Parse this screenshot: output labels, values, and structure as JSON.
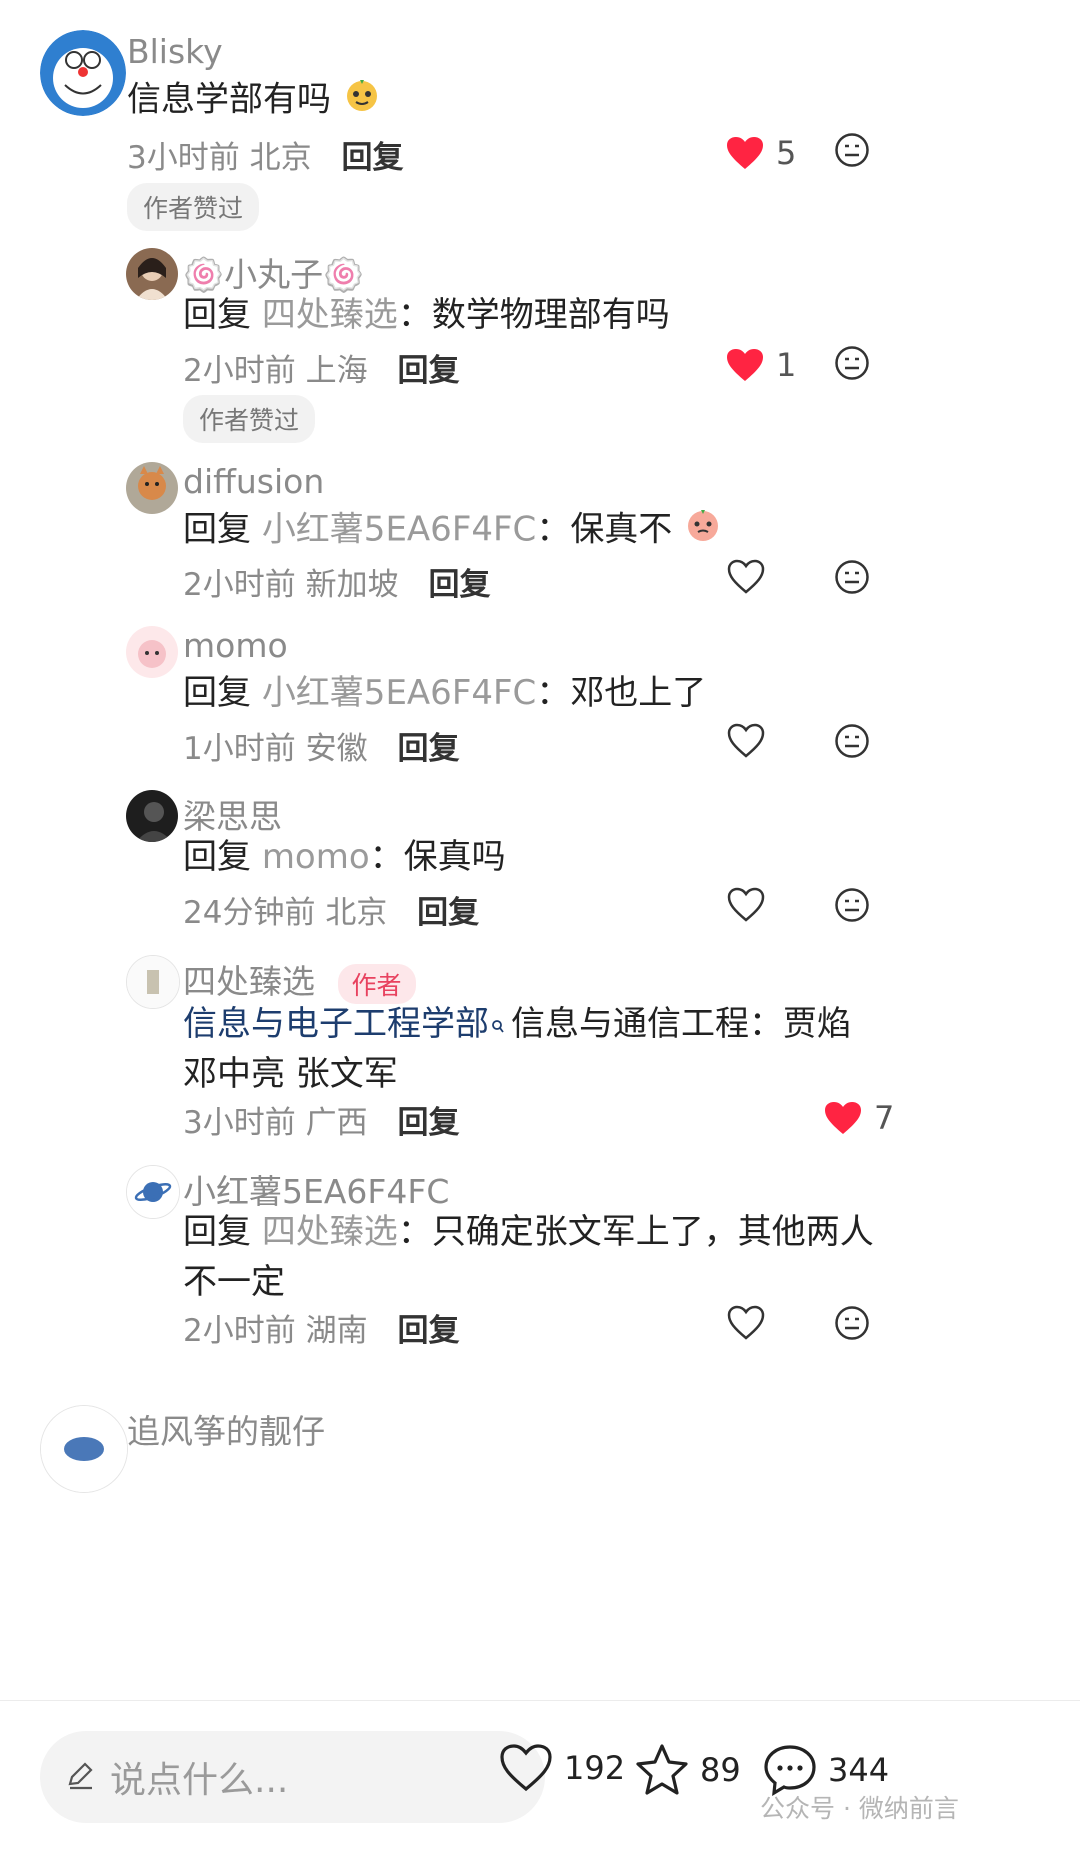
{
  "comments": [
    {
      "name": "Blisky",
      "text": "信息学部有吗",
      "meta_time": "3小时前",
      "meta_loc": "北京",
      "reply": "回复",
      "likes": "5",
      "liked": true,
      "badge": "作者赞过"
    },
    {
      "name": "🍥小丸子🍥",
      "reply_prefix": "回复",
      "mention": "四处臻选",
      "sep": "：",
      "text": "数学物理部有吗",
      "meta_time": "2小时前",
      "meta_loc": "上海",
      "reply": "回复",
      "likes": "1",
      "liked": true,
      "badge": "作者赞过"
    },
    {
      "name": "diffusion",
      "reply_prefix": "回复",
      "mention": "小红薯5EA6F4FC",
      "sep": "：",
      "text": "保真不",
      "meta_time": "2小时前",
      "meta_loc": "新加坡",
      "reply": "回复"
    },
    {
      "name": "momo",
      "reply_prefix": "回复",
      "mention": "小红薯5EA6F4FC",
      "sep": "：",
      "text": "邓也上了",
      "meta_time": "1小时前",
      "meta_loc": "安徽",
      "reply": "回复"
    },
    {
      "name": "梁思思",
      "reply_prefix": "回复",
      "mention": "momo",
      "sep": "：",
      "text": "保真吗",
      "meta_time": "24分钟前",
      "meta_loc": "北京",
      "reply": "回复"
    },
    {
      "name": "四处臻选",
      "author_tag": "作者",
      "link": "信息与电子工程学部",
      "text": "信息与通信工程：贾焰 邓中亮 张文军",
      "meta_time": "3小时前",
      "meta_loc": "广西",
      "reply": "回复",
      "likes": "7",
      "liked": true
    },
    {
      "name": "小红薯5EA6F4FC",
      "reply_prefix": "回复",
      "mention": "四处臻选",
      "sep": "：",
      "text": "只确定张文军上了，其他两人不一定",
      "meta_time": "2小时前",
      "meta_loc": "湖南",
      "reply": "回复"
    },
    {
      "name": "追风筝的靓仔"
    }
  ],
  "bottom_bar": {
    "input_placeholder": "说点什么...",
    "likes": "192",
    "stars": "89",
    "comments": "344",
    "watermark": "公众号 · 微纳前言"
  },
  "colors": {
    "heart_red": "#ff2442",
    "author_tag": "#e8425f",
    "link": "#1d3d6e"
  }
}
